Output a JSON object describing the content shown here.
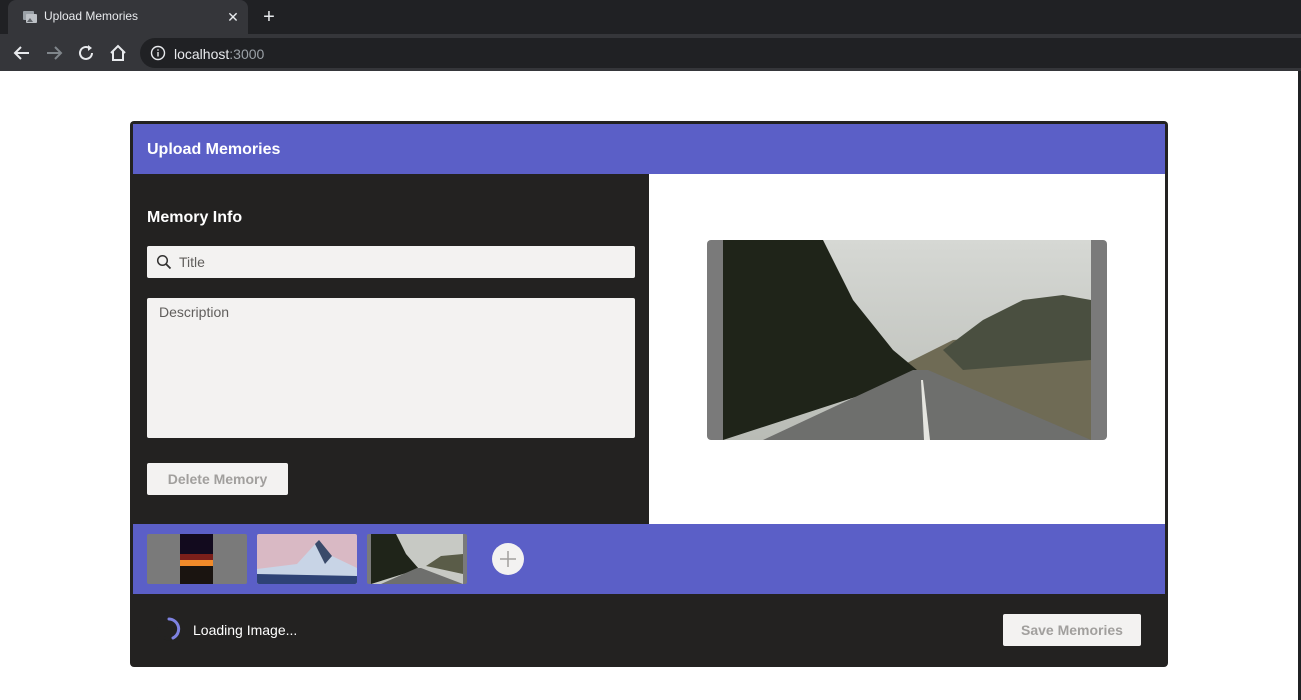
{
  "browser": {
    "tab_title": "Upload Memories",
    "url_host": "localhost",
    "url_port": ":3000"
  },
  "app": {
    "header_title": "Upload Memories",
    "section_title": "Memory Info",
    "title_placeholder": "Title",
    "description_placeholder": "Description",
    "delete_button": "Delete Memory",
    "save_button": "Save Memories",
    "loading_text": "Loading Image...",
    "accent_color": "#5b5fc7",
    "icons": [
      "search-icon",
      "plus-icon",
      "spinner-icon"
    ]
  },
  "thumbnails": [
    {
      "name": "sunset-thumbnail"
    },
    {
      "name": "mountain-thumbnail"
    },
    {
      "name": "forest-road-thumbnail"
    }
  ]
}
